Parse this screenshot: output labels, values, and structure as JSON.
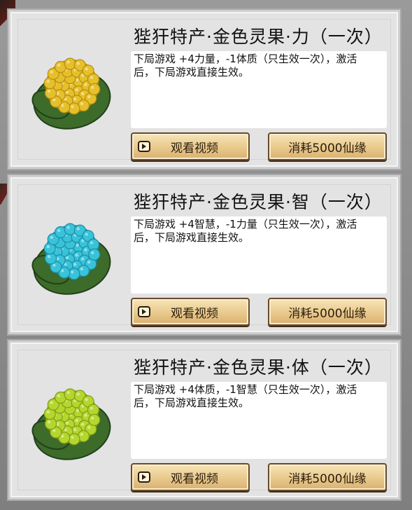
{
  "items": [
    {
      "title": "狴犴特产·金色灵果·力（一次）",
      "desc": "下局游戏 +4力量，-1体质（只生效一次），激活\n后，下局游戏直接生效。",
      "fruit_color": "#e6c02a",
      "fruit_shade": "#b88d12",
      "leaf_color": "#3d6b2a",
      "watch_label": "观看视频",
      "cost_label": "消耗5000仙缘"
    },
    {
      "title": "狴犴特产·金色灵果·智（一次）",
      "desc": "下局游戏 +4智慧，-1力量（只生效一次），激活\n后，下局游戏直接生效。",
      "fruit_color": "#38c3d9",
      "fruit_shade": "#1c8ea6",
      "leaf_color": "#3d6b2a",
      "watch_label": "观看视频",
      "cost_label": "消耗5000仙缘"
    },
    {
      "title": "狴犴特产·金色灵果·体（一次）",
      "desc": "下局游戏 +4体质，-1智慧（只生效一次），激活\n后，下局游戏直接生效。",
      "fruit_color": "#b5d62e",
      "fruit_shade": "#7e9e14",
      "leaf_color": "#3d6b2a",
      "watch_label": "观看视频",
      "cost_label": "消耗5000仙缘"
    }
  ],
  "icons": {
    "watch": "video-play-icon",
    "fruit": "cauliflower-fruit-icon"
  }
}
